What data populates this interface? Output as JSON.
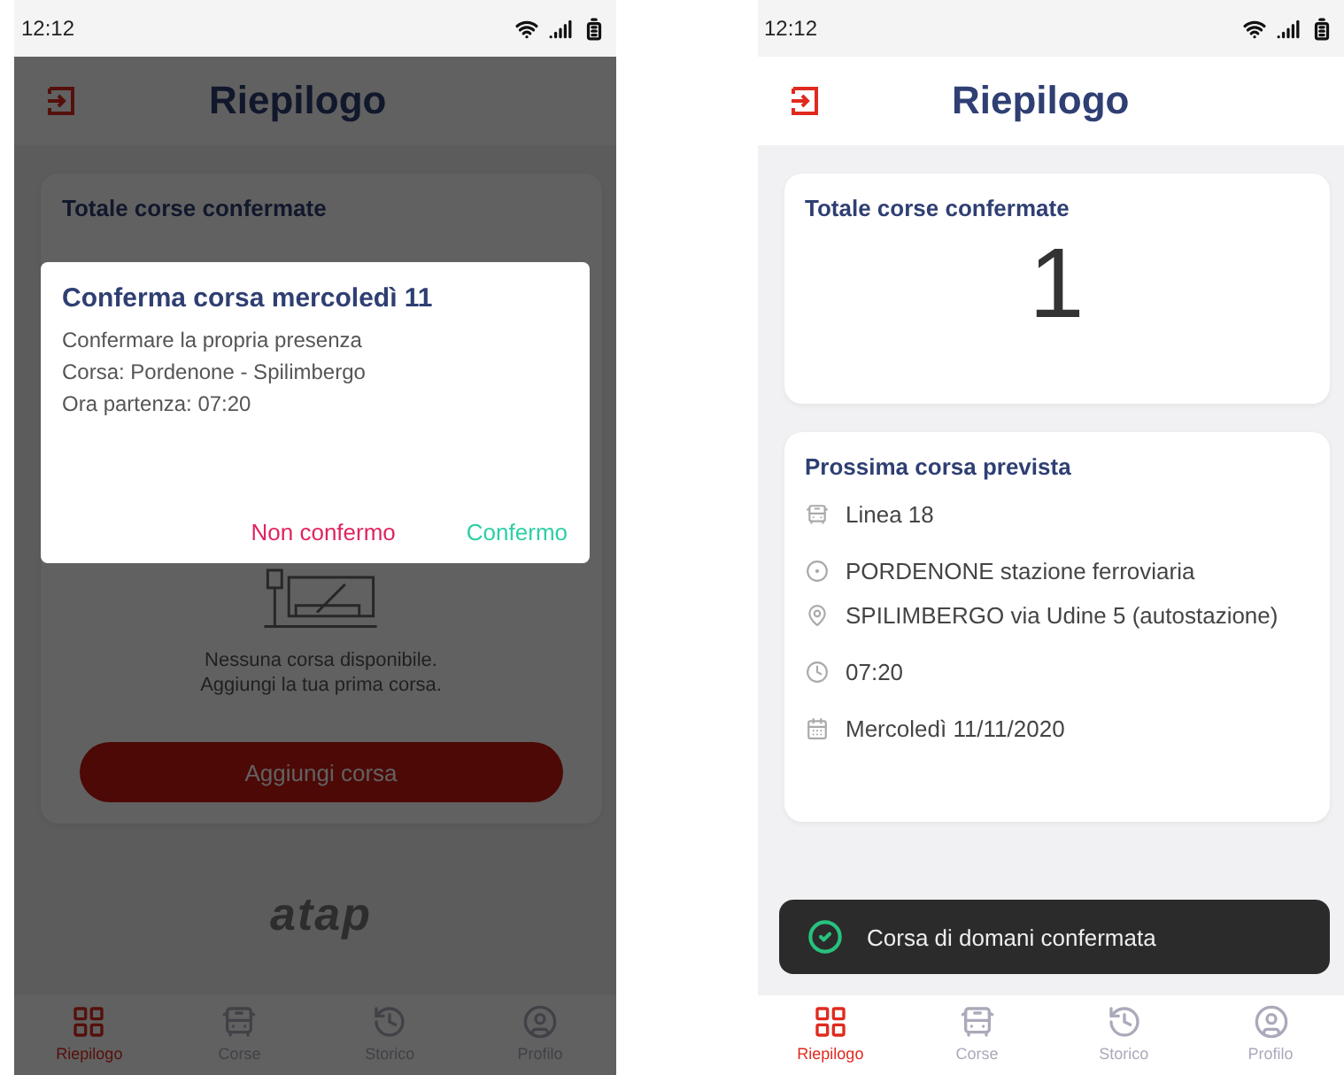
{
  "screens": [
    {
      "kind": "dialog",
      "status_bar": {
        "time": "12:12"
      },
      "header": {
        "title": "Riepilogo"
      },
      "total_card": {
        "title": "Totale corse confermate"
      },
      "empty_state": {
        "lines": [
          "Nessuna corsa disponibile.",
          "Aggiungi la tua prima corsa."
        ],
        "button": "Aggiungi corsa"
      },
      "logo": "atap",
      "dialog": {
        "title": "Conferma corsa mercoledì 11",
        "lines": [
          "Confermare la propria presenza",
          "Corsa: Pordenone - Spilimbergo",
          "Ora partenza: 07:20"
        ],
        "buttons": [
          {
            "label": "Non confermo",
            "kind": "negative"
          },
          {
            "label": "Confermo",
            "kind": "positive"
          }
        ]
      },
      "tabs": [
        {
          "label": "Riepilogo",
          "kind": "grid",
          "selected": true
        },
        {
          "label": "Corse",
          "kind": "bus",
          "selected": false
        },
        {
          "label": "Storico",
          "kind": "history",
          "selected": false
        },
        {
          "label": "Profilo",
          "kind": "user",
          "selected": false
        }
      ]
    },
    {
      "kind": "summary",
      "status_bar": {
        "time": "12:12"
      },
      "header": {
        "title": "Riepilogo"
      },
      "total_card": {
        "title": "Totale corse confermate",
        "value": "1"
      },
      "next_trip": {
        "title": "Prossima corsa prevista",
        "items": [
          {
            "kind": "line",
            "text": "Linea 18"
          },
          {
            "kind": "origin",
            "text": "PORDENONE stazione ferroviaria"
          },
          {
            "kind": "destination",
            "text": "SPILIMBERGO via Udine 5 (autostazione)"
          },
          {
            "kind": "time",
            "text": "07:20"
          },
          {
            "kind": "date",
            "text": "Mercoledì 11/11/2020"
          }
        ]
      },
      "toast": {
        "text": "Corsa di domani confermata"
      },
      "tabs": [
        {
          "label": "Riepilogo",
          "kind": "grid",
          "selected": true
        },
        {
          "label": "Corse",
          "kind": "bus",
          "selected": false
        },
        {
          "label": "Storico",
          "kind": "history",
          "selected": false
        },
        {
          "label": "Profilo",
          "kind": "user",
          "selected": false
        }
      ]
    }
  ]
}
